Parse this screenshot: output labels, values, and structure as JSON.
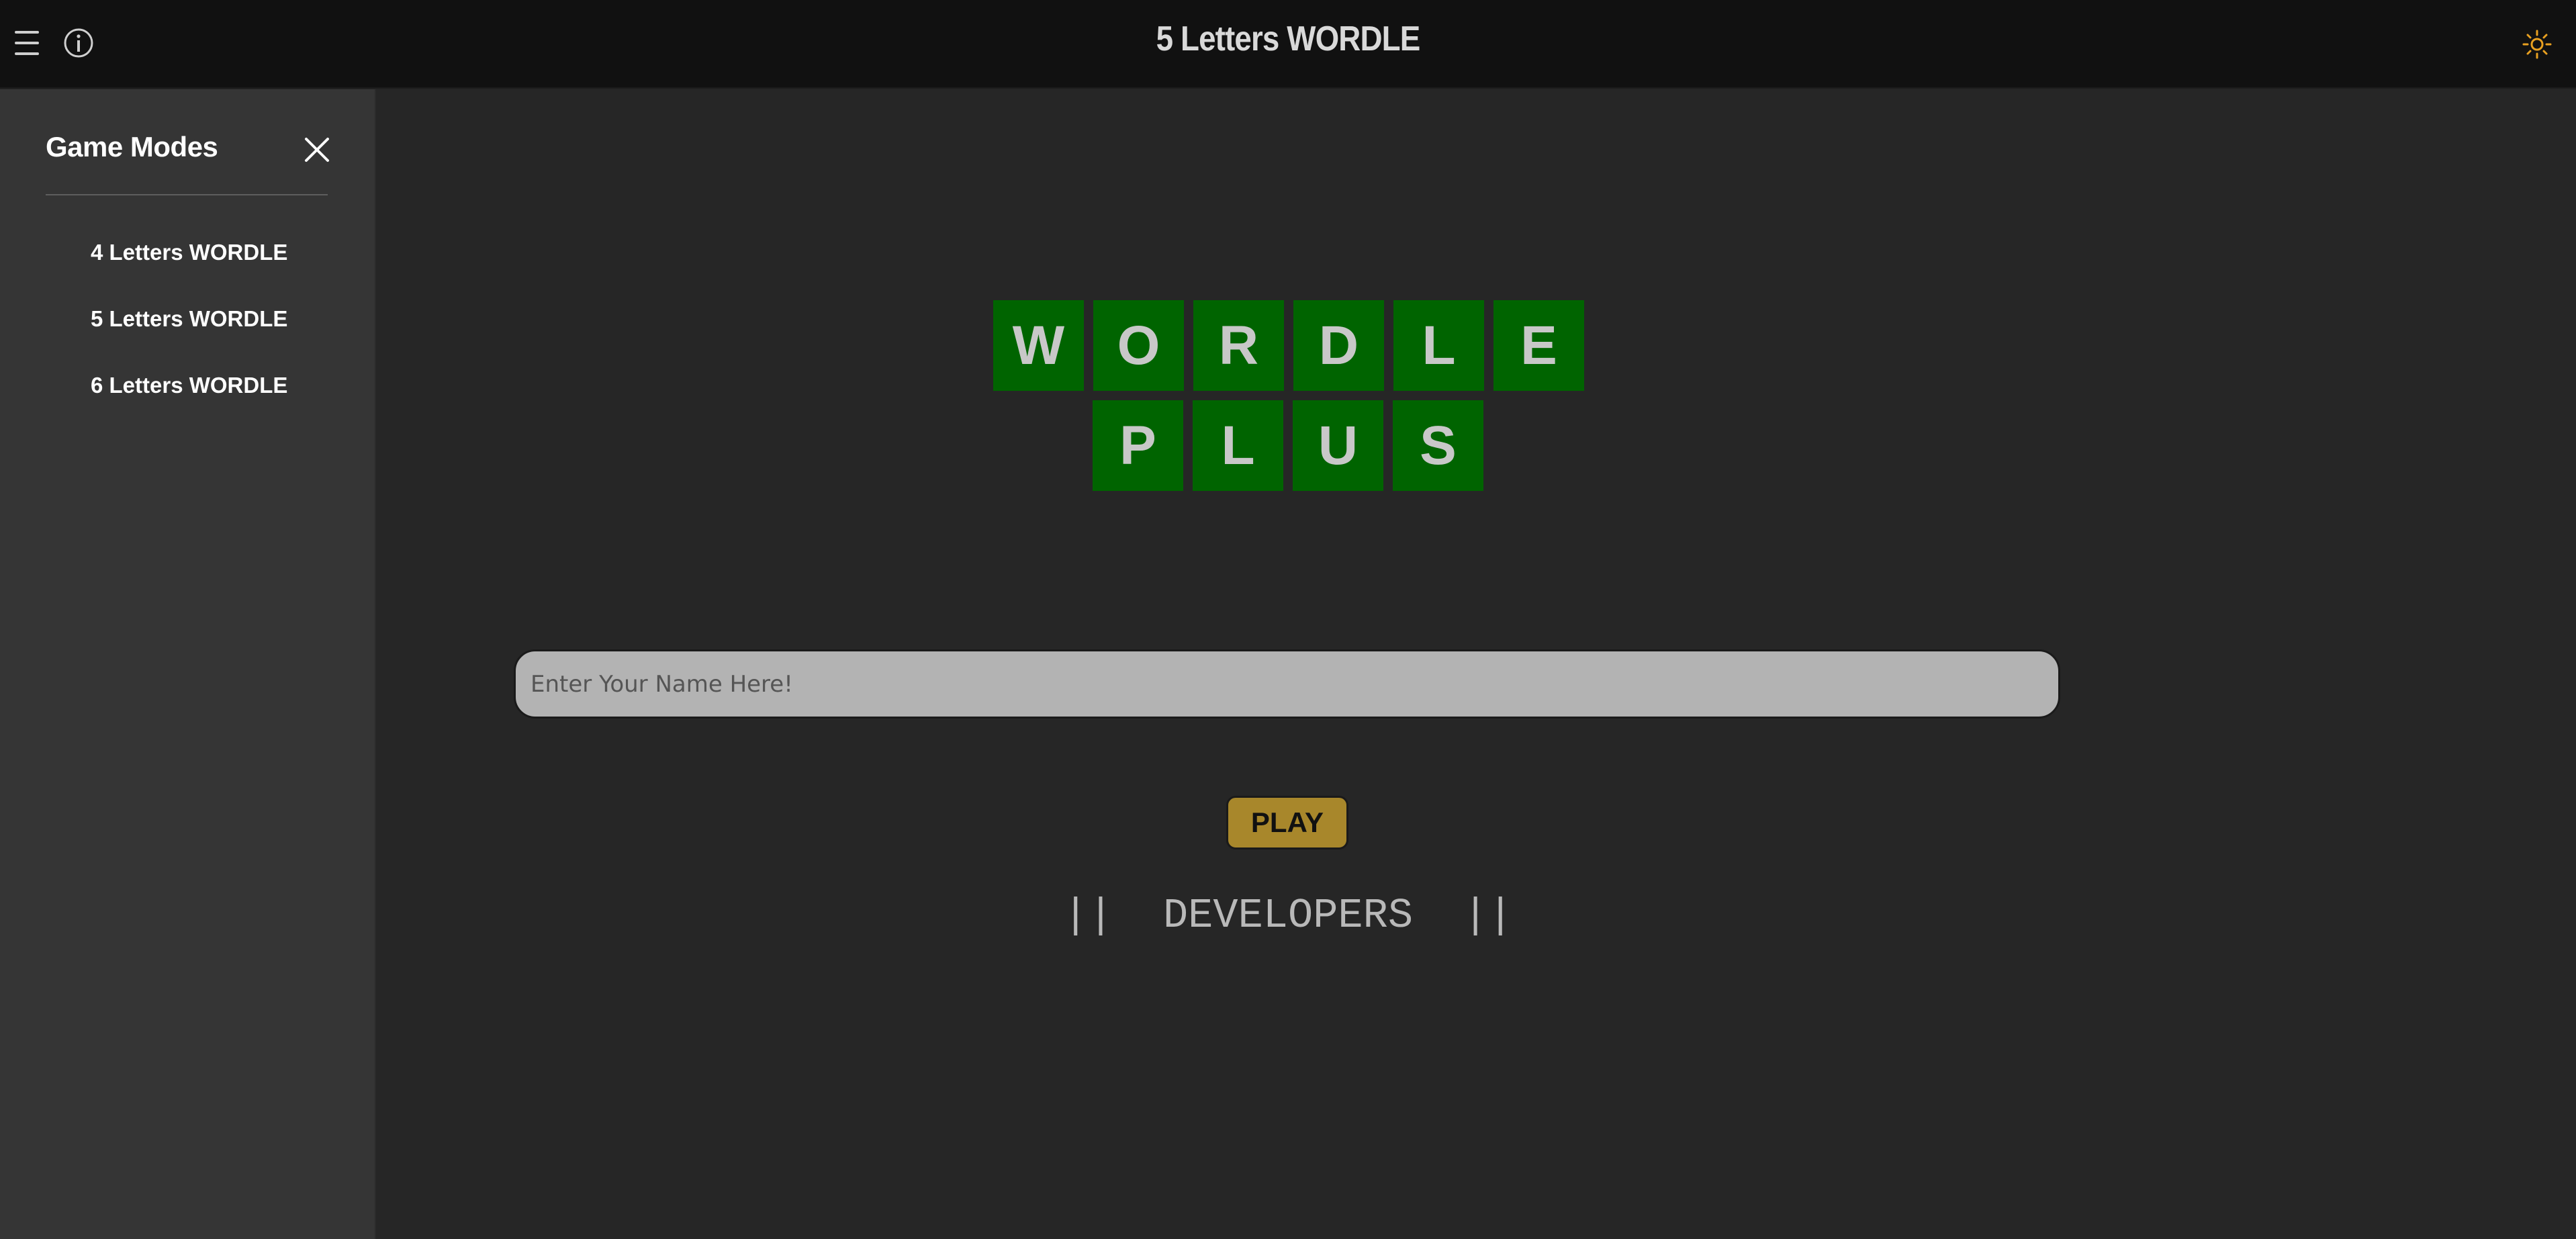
{
  "header": {
    "title": "5 Letters WORDLE",
    "menu_icon": "hamburger-menu-icon",
    "info_icon": "info-icon",
    "theme_icon": "sun-icon",
    "theme_icon_color": "#e8a020"
  },
  "sidebar": {
    "title": "Game Modes",
    "close_icon": "close-icon",
    "items": [
      {
        "label": "4 Letters WORDLE"
      },
      {
        "label": "5 Letters WORDLE"
      },
      {
        "label": "6 Letters WORDLE"
      }
    ]
  },
  "logo": {
    "row1": [
      "W",
      "O",
      "R",
      "D",
      "L",
      "E"
    ],
    "row2": [
      "P",
      "L",
      "U",
      "S"
    ],
    "tile_color": "#006400"
  },
  "form": {
    "name_placeholder": "Enter Your Name Here!",
    "play_label": "PLAY",
    "play_color": "#a8872b"
  },
  "footer": {
    "developers_label": "||  DEVELOPERS  ||"
  }
}
